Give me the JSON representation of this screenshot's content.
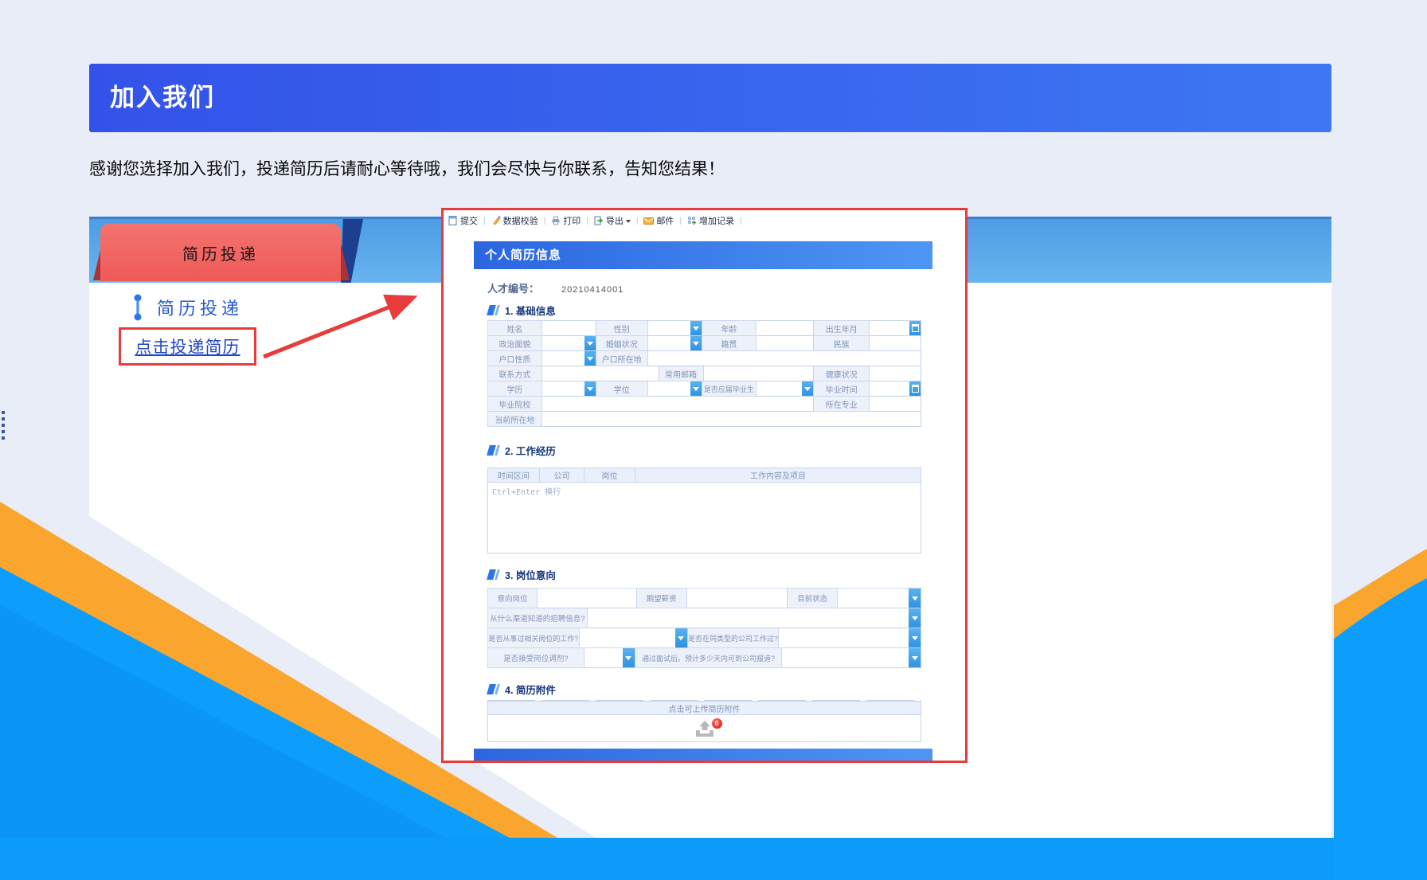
{
  "banner": {
    "title": "加入我们"
  },
  "intro": "感谢您选择加入我们，投递简历后请耐心等待哦，我们会尽快与你联系，告知您结果！",
  "tabs": {
    "resume_tab": "简历投递"
  },
  "sidebar": {
    "link_resume": "简历投递",
    "link_click_submit": "点击投递简历"
  },
  "toolbar": {
    "items": [
      {
        "label": "提交",
        "icon": "submit-doc-icon"
      },
      {
        "label": "数据校验",
        "icon": "validate-wand-icon"
      },
      {
        "label": "打印",
        "icon": "printer-icon"
      },
      {
        "label": "导出",
        "icon": "export-icon"
      },
      {
        "label": "邮件",
        "icon": "mail-icon"
      },
      {
        "label": "增加记录",
        "icon": "add-record-icon"
      }
    ]
  },
  "form": {
    "title": "个人简历信息",
    "talent_label": "人才编号：",
    "talent_value": "20210414001",
    "sections": {
      "s1": "1. 基础信息",
      "s2": "2. 工作经历",
      "s3": "3. 岗位意向",
      "s4": "4. 简历附件"
    },
    "basic": {
      "name": "姓名",
      "gender": "性别",
      "age": "年龄",
      "birth": "出生年月",
      "political": "政治面貌",
      "marital": "婚姻状况",
      "native_place": "籍贯",
      "ethnicity": "民族",
      "hukou_type": "户口性质",
      "hukou_location": "户口所在地",
      "contact": "联系方式",
      "email": "常用邮箱",
      "health": "健康状况",
      "education": "学历",
      "degree": "学位",
      "is_fresh_graduate": "是否应届毕业生",
      "graduation_time": "毕业时间",
      "school": "毕业院校",
      "major": "所在专业",
      "current_location": "当前所在地"
    },
    "work": {
      "headers": [
        "时间区间",
        "公司",
        "岗位",
        "工作内容及项目"
      ],
      "hint": "Ctrl+Enter 换行"
    },
    "intention": {
      "target_position": "意向岗位",
      "expected_salary": "期望薪资",
      "current_status": "目前状态",
      "channel": "从什么渠道知道的招聘信息?",
      "related_experience": "是否从事过相关岗位的工作?",
      "same_type_company": "是否在同类型的公司工作过?",
      "accept_adjustment": "是否接受岗位调剂?",
      "report_days": "通过面试后，预计多少天内可到公司报道?"
    },
    "attachment": {
      "upload_text": "点击可上传简历附件",
      "count": "0"
    }
  },
  "colors": {
    "banner_blue": "#3352e9",
    "strip_blue": "#57a3e6",
    "tab_red": "#f2615e",
    "accent_red": "#e83c3c",
    "link_blue": "#2553d6",
    "form_header_blue": "#2e6fe3",
    "control_blue": "#3fa0e8",
    "deco_bright_blue": "#0d9efc",
    "deco_orange": "#faa62e",
    "badge_red": "#d91616"
  }
}
